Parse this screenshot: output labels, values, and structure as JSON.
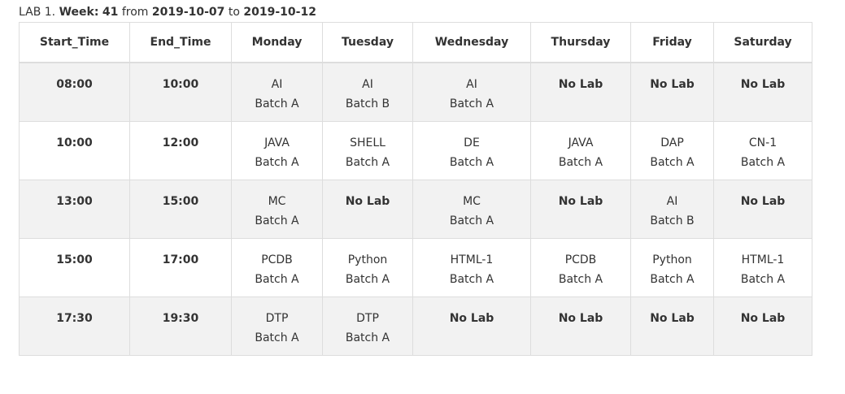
{
  "caption": {
    "lab": "LAB 1.",
    "week_label": "Week:",
    "week_number": "41",
    "from_word": "from",
    "start_date": "2019-10-07",
    "to_word": "to",
    "end_date": "2019-10-12"
  },
  "headers": [
    "Start_Time",
    "End_Time",
    "Monday",
    "Tuesday",
    "Wednesday",
    "Thursday",
    "Friday",
    "Saturday"
  ],
  "rows": [
    {
      "start": "08:00",
      "end": "10:00",
      "cells": [
        {
          "subject": "AI",
          "batch": "Batch A"
        },
        {
          "subject": "AI",
          "batch": "Batch B"
        },
        {
          "subject": "AI",
          "batch": "Batch A"
        },
        {
          "nolab": "No Lab"
        },
        {
          "nolab": "No Lab"
        },
        {
          "nolab": "No Lab"
        }
      ]
    },
    {
      "start": "10:00",
      "end": "12:00",
      "cells": [
        {
          "subject": "JAVA",
          "batch": "Batch A"
        },
        {
          "subject": "SHELL",
          "batch": "Batch A"
        },
        {
          "subject": "DE",
          "batch": "Batch A"
        },
        {
          "subject": "JAVA",
          "batch": "Batch A"
        },
        {
          "subject": "DAP",
          "batch": "Batch A"
        },
        {
          "subject": "CN-1",
          "batch": "Batch A"
        }
      ]
    },
    {
      "start": "13:00",
      "end": "15:00",
      "cells": [
        {
          "subject": "MC",
          "batch": "Batch A"
        },
        {
          "nolab": "No Lab"
        },
        {
          "subject": "MC",
          "batch": "Batch A"
        },
        {
          "nolab": "No Lab"
        },
        {
          "subject": "AI",
          "batch": "Batch B"
        },
        {
          "nolab": "No Lab"
        }
      ]
    },
    {
      "start": "15:00",
      "end": "17:00",
      "cells": [
        {
          "subject": "PCDB",
          "batch": "Batch A"
        },
        {
          "subject": "Python",
          "batch": "Batch A"
        },
        {
          "subject": "HTML-1",
          "batch": "Batch A"
        },
        {
          "subject": "PCDB",
          "batch": "Batch A"
        },
        {
          "subject": "Python",
          "batch": "Batch A"
        },
        {
          "subject": "HTML-1",
          "batch": "Batch A"
        }
      ]
    },
    {
      "start": "17:30",
      "end": "19:30",
      "cells": [
        {
          "subject": "DTP",
          "batch": "Batch A"
        },
        {
          "subject": "DTP",
          "batch": "Batch A"
        },
        {
          "nolab": "No Lab"
        },
        {
          "nolab": "No Lab"
        },
        {
          "nolab": "No Lab"
        },
        {
          "nolab": "No Lab"
        }
      ]
    }
  ]
}
